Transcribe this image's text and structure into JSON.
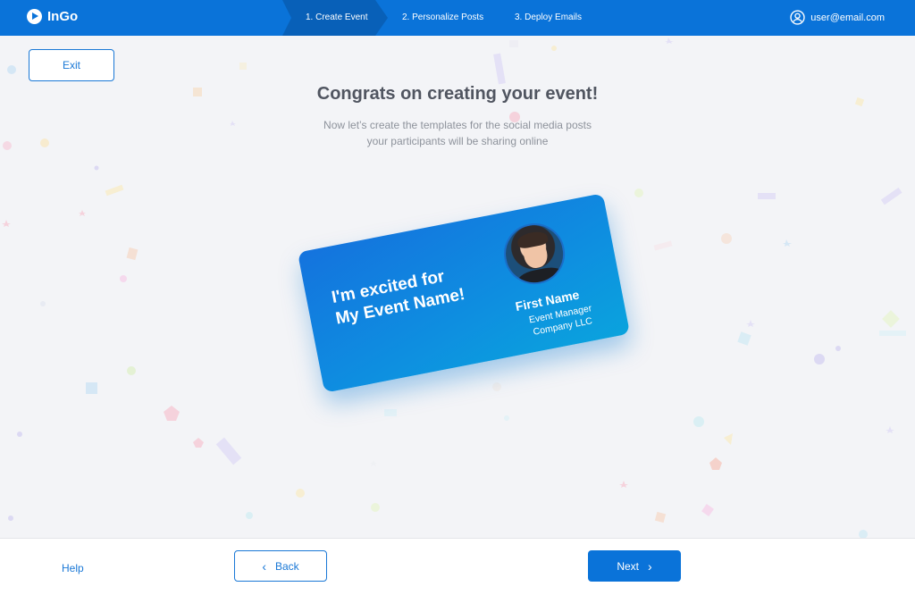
{
  "app": {
    "name": "InGo"
  },
  "steps": [
    {
      "label": "1. Create Event",
      "active": true
    },
    {
      "label": "2. Personalize Posts",
      "active": false
    },
    {
      "label": "3. Deploy Emails",
      "active": false
    }
  ],
  "user": {
    "email": "user@email.com"
  },
  "exit_label": "Exit",
  "hero": {
    "title": "Congrats on creating your event!",
    "subtitle": "Now let’s create the templates for the social media posts your participants will be sharing online"
  },
  "card": {
    "headline_line1": "I'm excited for",
    "headline_line2": "My Event Name!",
    "name": "First Name",
    "role": "Event Manager",
    "company": "Company LLC"
  },
  "footer": {
    "help_label": "Help",
    "back_label": "Back",
    "next_label": "Next"
  },
  "colors": {
    "primary": "#0a73d9",
    "primary_dark": "#0860b8",
    "background": "#f3f4f7"
  },
  "icons": {
    "logo": "play-circle-icon",
    "user": "user-circle-icon",
    "back": "chevron-left-icon",
    "next": "chevron-right-icon"
  }
}
